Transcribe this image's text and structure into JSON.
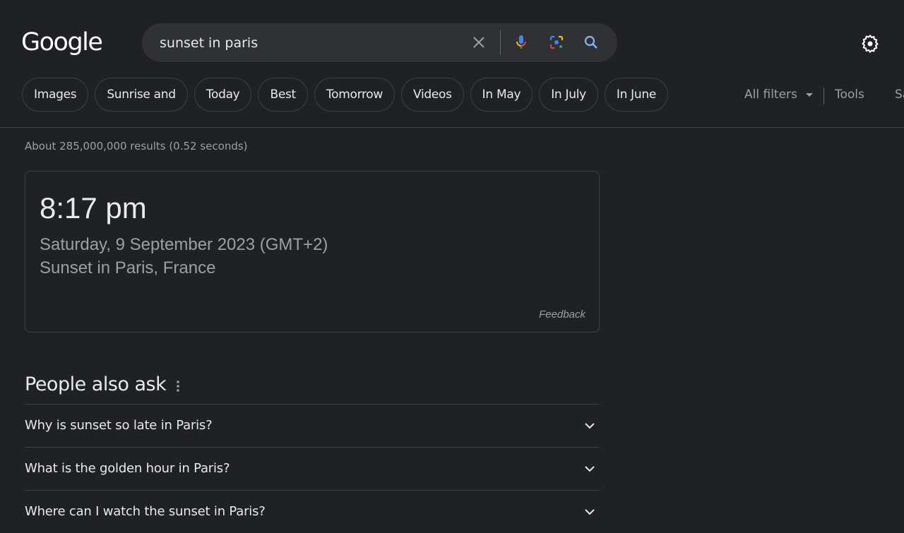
{
  "header": {
    "logo": "Google",
    "search_value": "sunset in paris",
    "icons": [
      "close-icon",
      "mic-icon",
      "lens-icon",
      "search-icon",
      "gear-icon"
    ]
  },
  "chips": [
    "Images",
    "Sunrise and",
    "Today",
    "Best",
    "Tomorrow",
    "Videos",
    "In May",
    "In July",
    "In June"
  ],
  "filters": {
    "all_filters": "All filters",
    "tools": "Tools",
    "safesearch": "Sa"
  },
  "stats": "About 285,000,000 results (0.52 seconds)",
  "answer_card": {
    "time": "8:17 pm",
    "date": "Saturday, 9 September 2023 (GMT+2)",
    "place": "Sunset in Paris, France",
    "feedback": "Feedback"
  },
  "people_also_ask": {
    "title": "People also ask",
    "questions": [
      "Why is sunset so late in Paris?",
      "What is the golden hour in Paris?",
      "Where can I watch the sunset in Paris?"
    ]
  },
  "colors": {
    "background": "#202124",
    "searchbox": "#303134",
    "accent_blue": "#8ab4f8",
    "secondary_text": "#9aa0a6"
  }
}
